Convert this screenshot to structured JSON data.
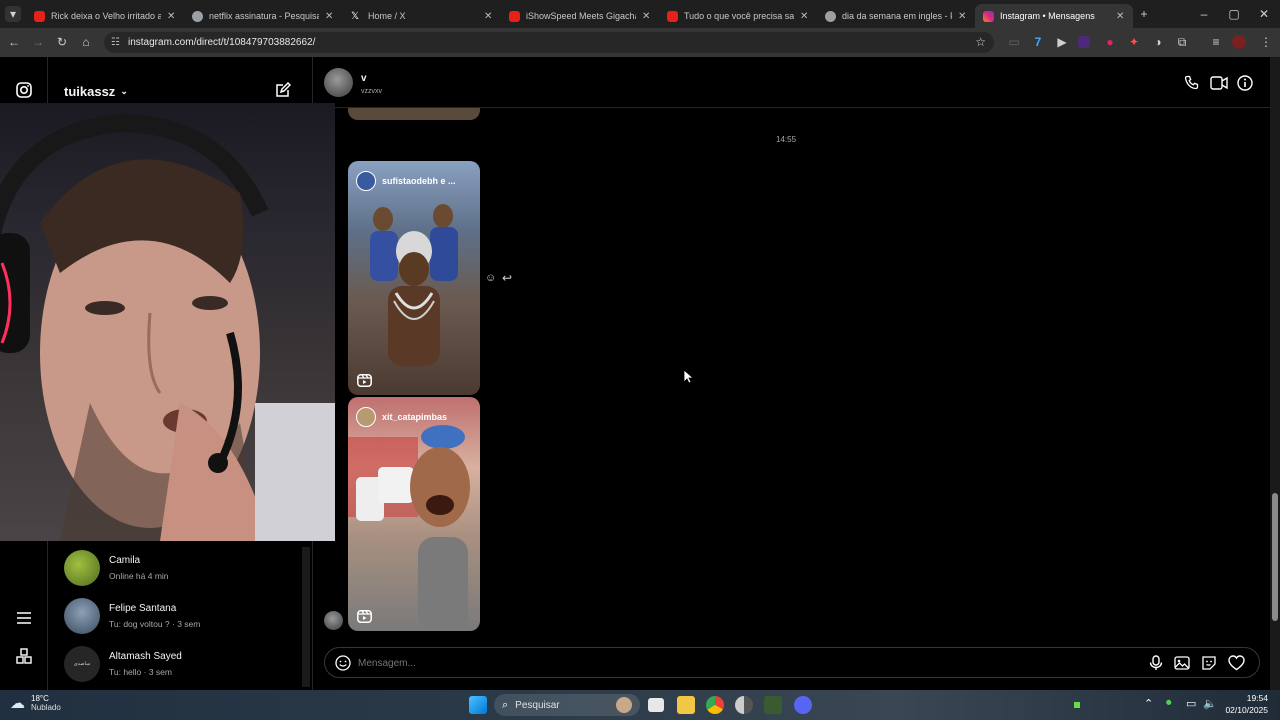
{
  "browser": {
    "tabs": [
      {
        "title": "Rick deixa o Velho irritado após",
        "color": "#e62117"
      },
      {
        "title": "netflix assinatura - Pesquisa Go",
        "color": "#9aa0a6"
      },
      {
        "title": "Home / X",
        "color": "#ffffff"
      },
      {
        "title": "iShowSpeed Meets Gigachad fr",
        "color": "#e62117"
      },
      {
        "title": "Tudo o que você precisa saber",
        "color": "#e62117"
      },
      {
        "title": "dia da semana em ingles - Pes",
        "color": "#9aa0a6"
      },
      {
        "title": "Instagram • Mensagens",
        "color": "#d6249f"
      }
    ],
    "url": "instagram.com/direct/t/108479703882662/"
  },
  "sidebar": {
    "username": "tuikassz",
    "conversations": [
      {
        "name": "Camila",
        "preview": "Online há 4 min",
        "color": "#6a8a2a"
      },
      {
        "name": "Felipe Santana",
        "preview": "Tu: dog voltou ? · 3 sem",
        "color": "#5a6e88"
      },
      {
        "name": "Altamash Sayed",
        "preview": "Tu: hello · 3 sem",
        "color": "#2a2a2a",
        "avatar_text": "ساصدی"
      }
    ]
  },
  "thread": {
    "contact_name": "v",
    "contact_handle": "vzzvxv",
    "timestamp": "14:55",
    "reels": [
      {
        "author": "sufistaodebh e ..."
      },
      {
        "author": "xit_catapimbas"
      }
    ],
    "composer_placeholder": "Mensagem..."
  },
  "taskbar": {
    "weather_temp": "18°C",
    "weather_desc": "Nublado",
    "search_label": "Pesquisar",
    "time": "19:54",
    "date": "02/10/2025"
  }
}
